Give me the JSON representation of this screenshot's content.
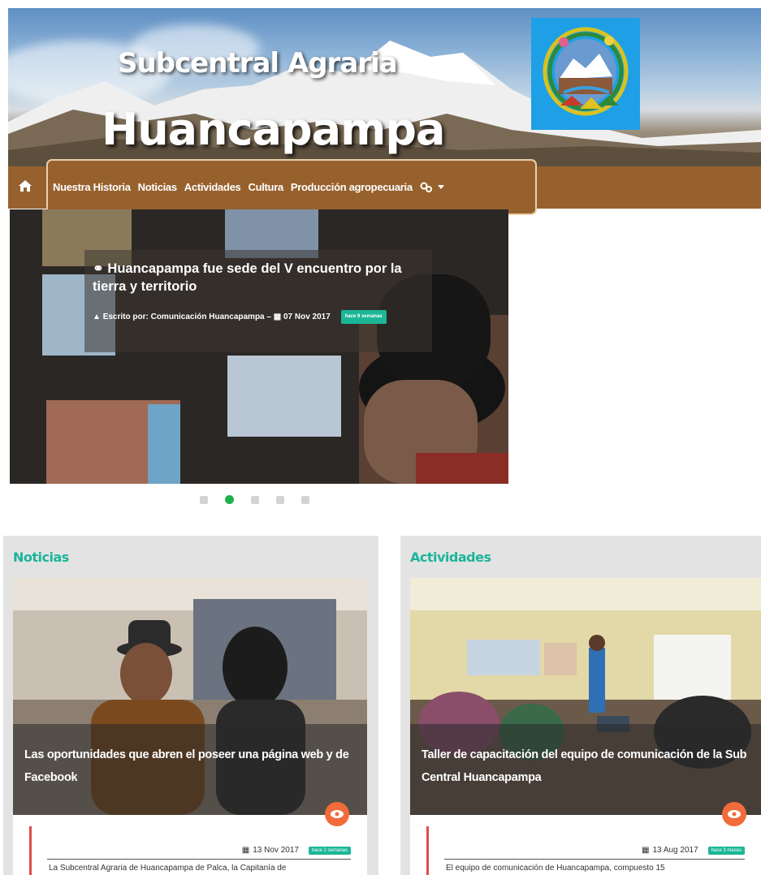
{
  "header": {
    "title_line1": "Subcentral Agraria",
    "title_line2": "Huancapampa",
    "emblem_icon": "municipal-emblem-icon"
  },
  "nav": {
    "home_icon": "home-icon",
    "items": [
      {
        "label": "Nuestra Historia"
      },
      {
        "label": "Noticias"
      },
      {
        "label": "Actividades"
      },
      {
        "label": "Cultura"
      },
      {
        "label": "Producción agropecuaria"
      }
    ],
    "search_icon": "search-icon",
    "dropdown_icon": "caret-down-icon"
  },
  "carousel": {
    "title": "Huancapampa fue sede del V encuentro por la tierra y territorio",
    "author_prefix": "Escrito por:",
    "author": "Comunicación Huancapampa",
    "separator": "–",
    "date": "07 Nov 2017",
    "ago_badge": "hace 9 semanas",
    "slides_count": 5,
    "active_slide": 2
  },
  "noticias": {
    "section_title": "Noticias",
    "card_title": "Las oportunidades que abren el poseer una página web y de Facebook",
    "date": "13 Nov 2017",
    "ago_badge": "hace 2 semanas",
    "excerpt": "La Subcentral Agraria de Huancapampa de Palca, la Capitanía de"
  },
  "actividades": {
    "section_title": "Actividades",
    "card_title": "Taller de capacitación del equipo de comunicación de la Sub Central Huancapampa",
    "date": "13 Aug 2017",
    "ago_badge": "hace 3 meses",
    "excerpt": "El equipo de comunicación de Huancapampa,  compuesto 15"
  },
  "colors": {
    "nav_brown": "#97612d",
    "accent_teal": "#1ab59b",
    "eye_orange": "#f26b3a",
    "active_dot": "#1fb04a"
  }
}
